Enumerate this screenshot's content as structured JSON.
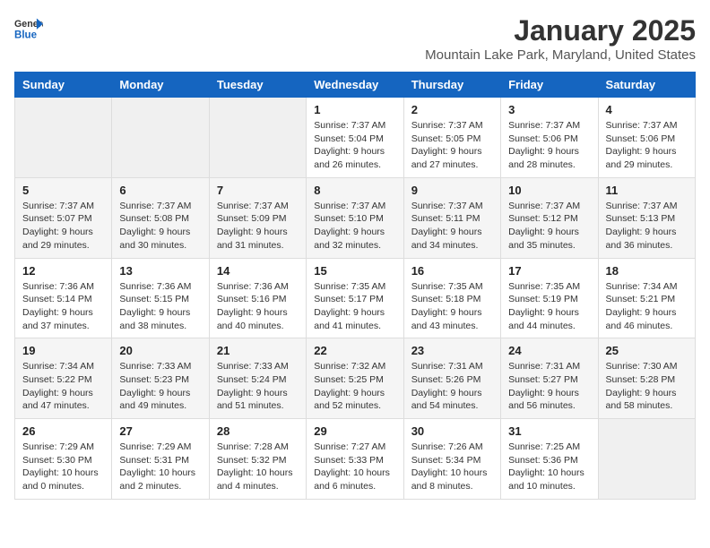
{
  "header": {
    "logo_general": "General",
    "logo_blue": "Blue",
    "month": "January 2025",
    "location": "Mountain Lake Park, Maryland, United States"
  },
  "weekdays": [
    "Sunday",
    "Monday",
    "Tuesday",
    "Wednesday",
    "Thursday",
    "Friday",
    "Saturday"
  ],
  "weeks": [
    [
      {
        "day": "",
        "info": ""
      },
      {
        "day": "",
        "info": ""
      },
      {
        "day": "",
        "info": ""
      },
      {
        "day": "1",
        "info": "Sunrise: 7:37 AM\nSunset: 5:04 PM\nDaylight: 9 hours\nand 26 minutes."
      },
      {
        "day": "2",
        "info": "Sunrise: 7:37 AM\nSunset: 5:05 PM\nDaylight: 9 hours\nand 27 minutes."
      },
      {
        "day": "3",
        "info": "Sunrise: 7:37 AM\nSunset: 5:06 PM\nDaylight: 9 hours\nand 28 minutes."
      },
      {
        "day": "4",
        "info": "Sunrise: 7:37 AM\nSunset: 5:06 PM\nDaylight: 9 hours\nand 29 minutes."
      }
    ],
    [
      {
        "day": "5",
        "info": "Sunrise: 7:37 AM\nSunset: 5:07 PM\nDaylight: 9 hours\nand 29 minutes."
      },
      {
        "day": "6",
        "info": "Sunrise: 7:37 AM\nSunset: 5:08 PM\nDaylight: 9 hours\nand 30 minutes."
      },
      {
        "day": "7",
        "info": "Sunrise: 7:37 AM\nSunset: 5:09 PM\nDaylight: 9 hours\nand 31 minutes."
      },
      {
        "day": "8",
        "info": "Sunrise: 7:37 AM\nSunset: 5:10 PM\nDaylight: 9 hours\nand 32 minutes."
      },
      {
        "day": "9",
        "info": "Sunrise: 7:37 AM\nSunset: 5:11 PM\nDaylight: 9 hours\nand 34 minutes."
      },
      {
        "day": "10",
        "info": "Sunrise: 7:37 AM\nSunset: 5:12 PM\nDaylight: 9 hours\nand 35 minutes."
      },
      {
        "day": "11",
        "info": "Sunrise: 7:37 AM\nSunset: 5:13 PM\nDaylight: 9 hours\nand 36 minutes."
      }
    ],
    [
      {
        "day": "12",
        "info": "Sunrise: 7:36 AM\nSunset: 5:14 PM\nDaylight: 9 hours\nand 37 minutes."
      },
      {
        "day": "13",
        "info": "Sunrise: 7:36 AM\nSunset: 5:15 PM\nDaylight: 9 hours\nand 38 minutes."
      },
      {
        "day": "14",
        "info": "Sunrise: 7:36 AM\nSunset: 5:16 PM\nDaylight: 9 hours\nand 40 minutes."
      },
      {
        "day": "15",
        "info": "Sunrise: 7:35 AM\nSunset: 5:17 PM\nDaylight: 9 hours\nand 41 minutes."
      },
      {
        "day": "16",
        "info": "Sunrise: 7:35 AM\nSunset: 5:18 PM\nDaylight: 9 hours\nand 43 minutes."
      },
      {
        "day": "17",
        "info": "Sunrise: 7:35 AM\nSunset: 5:19 PM\nDaylight: 9 hours\nand 44 minutes."
      },
      {
        "day": "18",
        "info": "Sunrise: 7:34 AM\nSunset: 5:21 PM\nDaylight: 9 hours\nand 46 minutes."
      }
    ],
    [
      {
        "day": "19",
        "info": "Sunrise: 7:34 AM\nSunset: 5:22 PM\nDaylight: 9 hours\nand 47 minutes."
      },
      {
        "day": "20",
        "info": "Sunrise: 7:33 AM\nSunset: 5:23 PM\nDaylight: 9 hours\nand 49 minutes."
      },
      {
        "day": "21",
        "info": "Sunrise: 7:33 AM\nSunset: 5:24 PM\nDaylight: 9 hours\nand 51 minutes."
      },
      {
        "day": "22",
        "info": "Sunrise: 7:32 AM\nSunset: 5:25 PM\nDaylight: 9 hours\nand 52 minutes."
      },
      {
        "day": "23",
        "info": "Sunrise: 7:31 AM\nSunset: 5:26 PM\nDaylight: 9 hours\nand 54 minutes."
      },
      {
        "day": "24",
        "info": "Sunrise: 7:31 AM\nSunset: 5:27 PM\nDaylight: 9 hours\nand 56 minutes."
      },
      {
        "day": "25",
        "info": "Sunrise: 7:30 AM\nSunset: 5:28 PM\nDaylight: 9 hours\nand 58 minutes."
      }
    ],
    [
      {
        "day": "26",
        "info": "Sunrise: 7:29 AM\nSunset: 5:30 PM\nDaylight: 10 hours\nand 0 minutes."
      },
      {
        "day": "27",
        "info": "Sunrise: 7:29 AM\nSunset: 5:31 PM\nDaylight: 10 hours\nand 2 minutes."
      },
      {
        "day": "28",
        "info": "Sunrise: 7:28 AM\nSunset: 5:32 PM\nDaylight: 10 hours\nand 4 minutes."
      },
      {
        "day": "29",
        "info": "Sunrise: 7:27 AM\nSunset: 5:33 PM\nDaylight: 10 hours\nand 6 minutes."
      },
      {
        "day": "30",
        "info": "Sunrise: 7:26 AM\nSunset: 5:34 PM\nDaylight: 10 hours\nand 8 minutes."
      },
      {
        "day": "31",
        "info": "Sunrise: 7:25 AM\nSunset: 5:36 PM\nDaylight: 10 hours\nand 10 minutes."
      },
      {
        "day": "",
        "info": ""
      }
    ]
  ]
}
